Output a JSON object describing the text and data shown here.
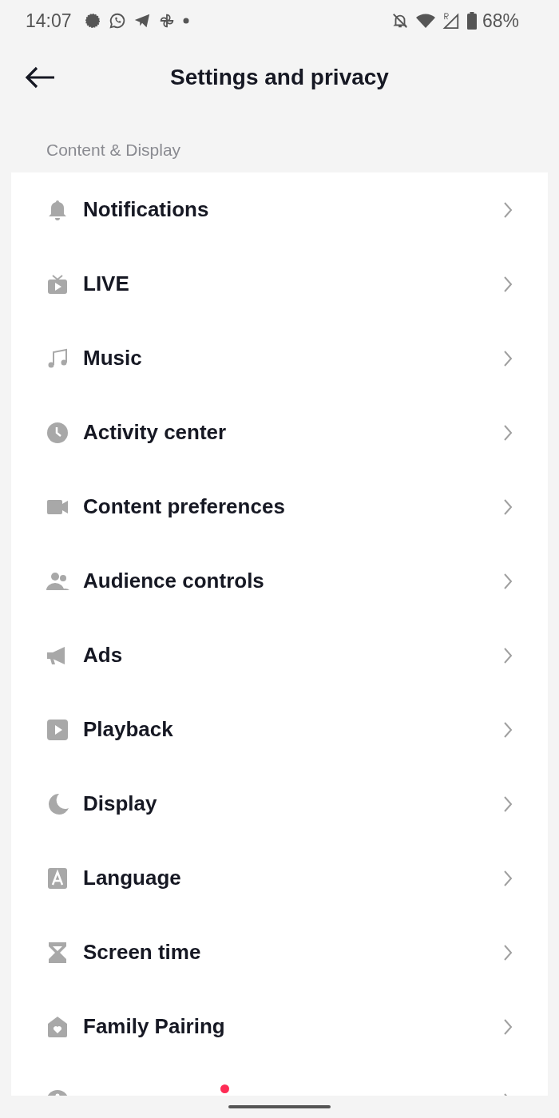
{
  "status_bar": {
    "time": "14:07",
    "battery": "68%"
  },
  "header": {
    "title": "Settings and privacy"
  },
  "section": {
    "title": "Content & Display"
  },
  "items": [
    {
      "label": "Notifications"
    },
    {
      "label": "LIVE"
    },
    {
      "label": "Music"
    },
    {
      "label": "Activity center"
    },
    {
      "label": "Content preferences"
    },
    {
      "label": "Audience controls"
    },
    {
      "label": "Ads"
    },
    {
      "label": "Playback"
    },
    {
      "label": "Display"
    },
    {
      "label": "Language"
    },
    {
      "label": "Screen time"
    },
    {
      "label": "Family Pairing"
    },
    {
      "new_badge": true
    }
  ]
}
